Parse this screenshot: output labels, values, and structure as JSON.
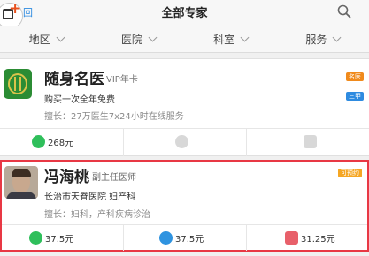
{
  "header": {
    "back_label": "回",
    "title": "全部专家",
    "back_icon": "back-plus-icon",
    "search_icon": "search-icon"
  },
  "filters": [
    {
      "label": "地区"
    },
    {
      "label": "医院"
    },
    {
      "label": "科室"
    },
    {
      "label": "服务"
    }
  ],
  "cards": [
    {
      "name": "随身名医",
      "title": "VIP年卡",
      "line1": "购买一次全年免费",
      "line2": "擅长：27万医生7x24小时在线服务",
      "badges": [
        "名医",
        "三甲"
      ],
      "prices": [
        {
          "icon": "chat-icon",
          "color": "#2fbf5b",
          "text": "268元"
        },
        {
          "icon": "phone-icon",
          "color": "#d8d8d8",
          "text": ""
        },
        {
          "icon": "calendar-icon",
          "color": "#d8d8d8",
          "text": ""
        }
      ]
    },
    {
      "name": "冯海桃",
      "title": "副主任医师",
      "line1": "长治市天脊医院 妇产科",
      "line2": "擅长：妇科，产科疾病诊治",
      "badges": [
        "可预约"
      ],
      "prices": [
        {
          "icon": "chat-icon",
          "color": "#2fbf5b",
          "text": "37.5元"
        },
        {
          "icon": "phone-icon",
          "color": "#2f93e0",
          "text": "37.5元"
        },
        {
          "icon": "calendar-icon",
          "color": "#e8606a",
          "text": "31.25元"
        }
      ]
    }
  ]
}
